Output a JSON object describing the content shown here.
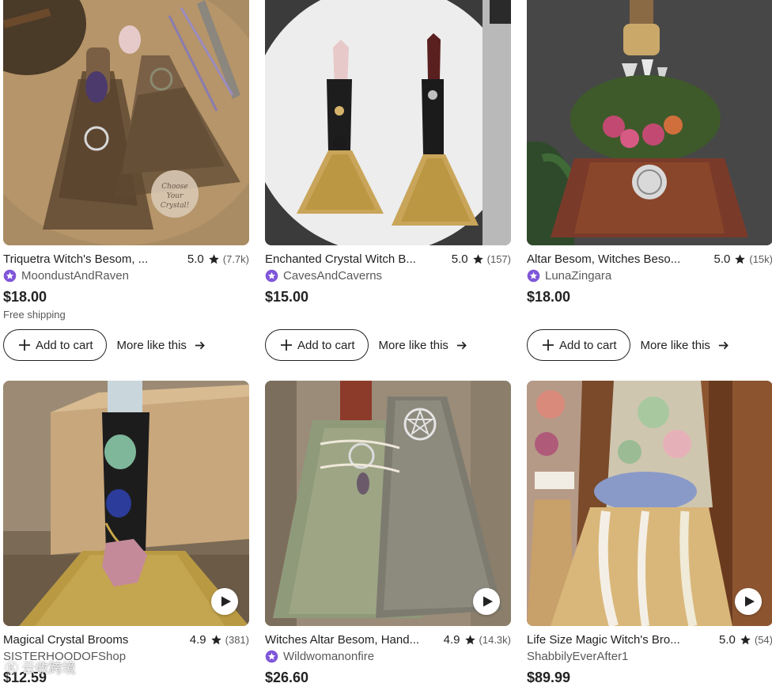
{
  "listings": [
    {
      "title": "Triquetra Witch's Besom, ...",
      "rating": "5.0",
      "reviews": "(7.7k)",
      "star_seller": true,
      "shop": "MoondustAndRaven",
      "price": "$18.00",
      "shipping": "Free shipping",
      "add_to_cart": "Add to cart",
      "more_like_this": "More like this",
      "has_video": false,
      "image_overlay": "Choose Your Crystal!"
    },
    {
      "title": "Enchanted Crystal Witch B...",
      "rating": "5.0",
      "reviews": "(157)",
      "star_seller": true,
      "shop": "CavesAndCaverns",
      "price": "$15.00",
      "add_to_cart": "Add to cart",
      "more_like_this": "More like this",
      "has_video": false
    },
    {
      "title": "Altar Besom, Witches Beso...",
      "rating": "5.0",
      "reviews": "(15k)",
      "star_seller": true,
      "shop": "LunaZingara",
      "price": "$18.00",
      "add_to_cart": "Add to cart",
      "more_like_this": "More like this",
      "has_video": false
    },
    {
      "title": "Magical Crystal Brooms",
      "rating": "4.9",
      "reviews": "(381)",
      "star_seller": false,
      "shop": "SISTERHOODOFShop",
      "price": "$12.59",
      "has_video": true
    },
    {
      "title": "Witches Altar Besom, Hand...",
      "rating": "4.9",
      "reviews": "(14.3k)",
      "star_seller": true,
      "shop": "Wildwomanonfire",
      "price": "$26.60",
      "has_video": true
    },
    {
      "title": "Life Size Magic Witch's Bro...",
      "rating": "5.0",
      "reviews": "(54)",
      "star_seller": false,
      "shop": "ShabbilyEverAfter1",
      "price": "$89.99",
      "has_video": true
    }
  ],
  "watermark": "Ⓚ 云收跨境",
  "colors": {
    "star_seller_badge": "#7f56d9",
    "text_primary": "#222222",
    "text_secondary": "#595959",
    "rating_star": "#222222"
  },
  "icons": {
    "rating": "star-icon",
    "seller": "star-seller-badge-icon",
    "cart": "plus-icon",
    "more": "arrow-right-icon",
    "video": "play-icon"
  }
}
